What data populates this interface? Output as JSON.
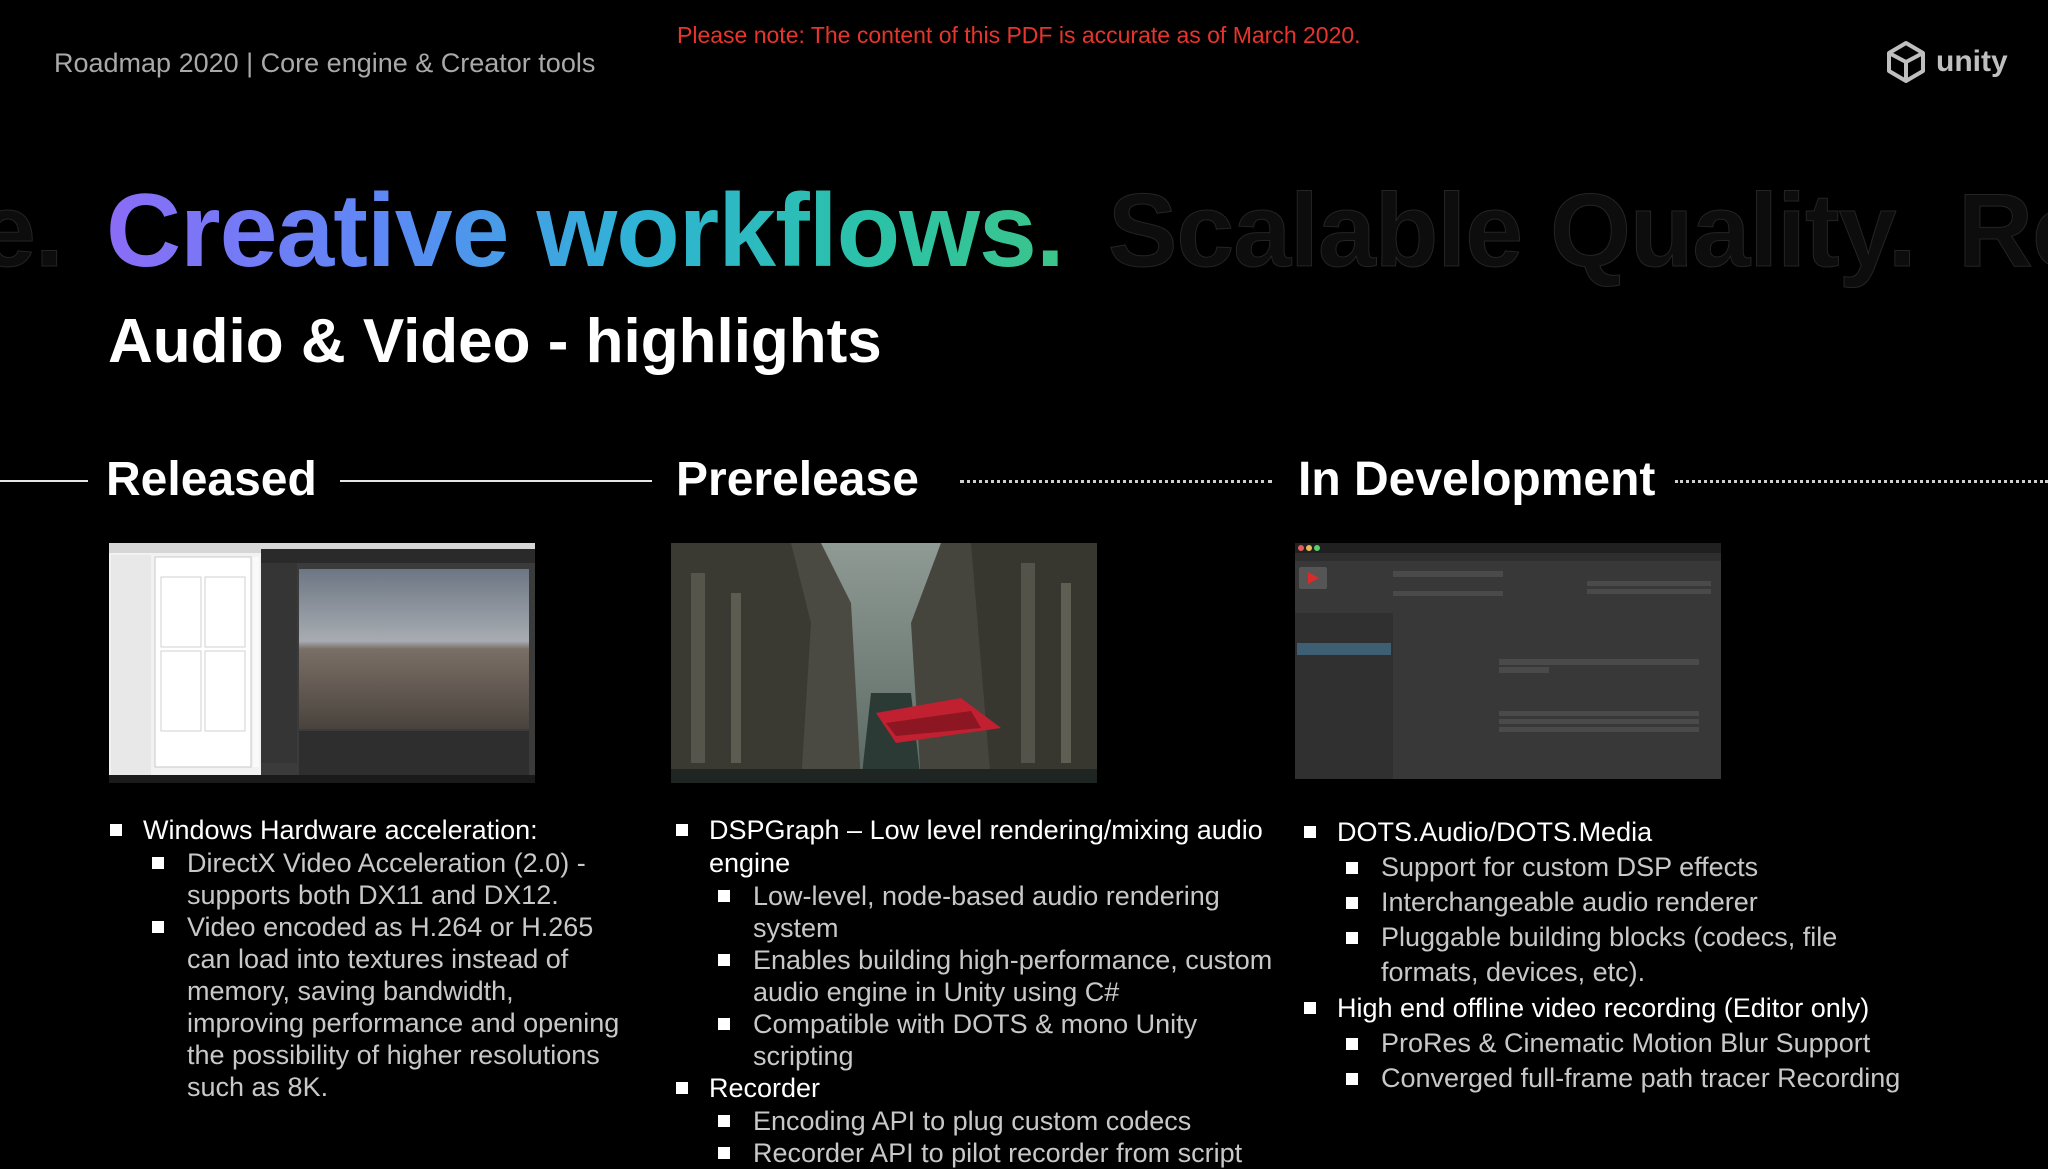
{
  "header": {
    "deck_title": "Roadmap 2020  | Core engine & Creator tools",
    "notice": "Please note: The content of this PDF is accurate as of March 2020.",
    "logo_text": "unity"
  },
  "headline": {
    "ghost_left": "e.",
    "main": "Creative workflows.",
    "ghost_right_1": "Scalable Quality.",
    "ghost_right_2": "Re"
  },
  "subtitle": "Audio & Video - highlights",
  "columns": [
    {
      "title": "Released",
      "image_alt": "Unity editor screenshot with profiler and scene view",
      "bullets": [
        {
          "text": "Windows Hardware acceleration:",
          "children": [
            "DirectX Video Acceleration (2.0) - supports both DX11 and DX12.",
            "Video encoded as H.264 or H.265 can load into textures instead of memory, saving bandwidth, improving performance and opening the possibility of higher resolutions such as 8K."
          ]
        }
      ]
    },
    {
      "title": "Prerelease",
      "image_alt": "Futuristic city render with red flying car",
      "bullets": [
        {
          "text": "DSPGraph – Low level rendering/mixing audio engine",
          "children": [
            "Low-level, node-based audio rendering system",
            "Enables building high-performance, custom audio engine in Unity using C#",
            "Compatible with DOTS & mono Unity scripting"
          ]
        },
        {
          "text": "Recorder",
          "children": [
            "Encoding API to plug custom codecs",
            "Recorder API to pilot recorder from script"
          ]
        }
      ]
    },
    {
      "title": "In Development",
      "image_alt": "Unity Recorder window screenshot",
      "bullets": [
        {
          "text": "DOTS.Audio/DOTS.Media",
          "children": [
            "Support for custom DSP effects",
            "Interchangeable audio renderer",
            "Pluggable building blocks (codecs, file formats, devices, etc)."
          ]
        },
        {
          "text": "High end offline video recording (Editor only)",
          "children": [
            "ProRes & Cinematic Motion Blur Support",
            "Converged full-frame path tracer Recording"
          ]
        }
      ]
    }
  ],
  "colors": {
    "background": "#000000",
    "notice": "#e8342c",
    "gradient_start": "#8b6cf6",
    "gradient_end": "#3cc58a"
  }
}
